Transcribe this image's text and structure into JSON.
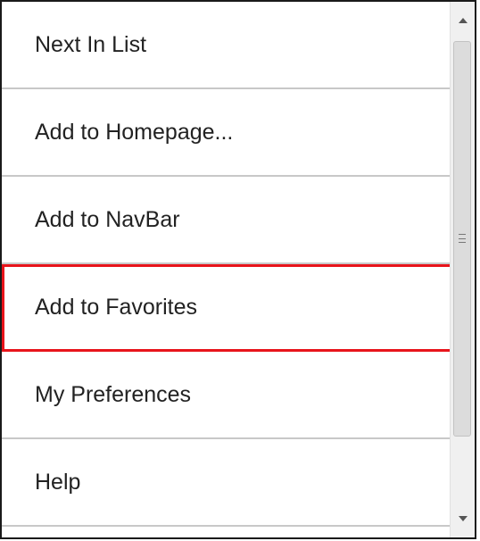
{
  "menu": {
    "items": [
      {
        "label": "Next In List"
      },
      {
        "label": "Add to Homepage..."
      },
      {
        "label": "Add to NavBar"
      },
      {
        "label": "Add to Favorites",
        "highlighted": true
      },
      {
        "label": "My Preferences"
      },
      {
        "label": "Help"
      }
    ]
  },
  "scrollbar": {
    "up_icon": "chevron-up-icon",
    "down_icon": "chevron-down-icon",
    "thumb_icon": "grip-lines-icon"
  },
  "colors": {
    "highlight_border": "#e8141b",
    "divider": "#c8c8c8",
    "text": "#222222"
  }
}
